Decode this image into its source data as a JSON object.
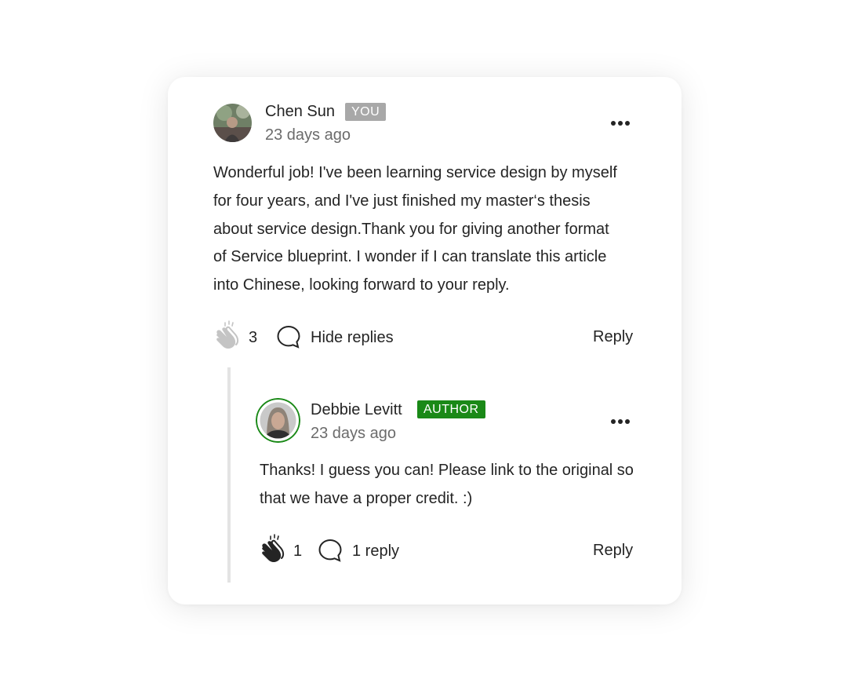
{
  "comment": {
    "author": "Chen Sun",
    "badge": "YOU",
    "time": "23 days ago",
    "text_lines": [
      "Wonderful job! I've been learning service design by myself",
      "for four years, and I've just finished my master‘s thesis",
      "about service design.Thank you for giving another format",
      "of Service blueprint. I wonder if I can translate this article",
      "into Chinese, looking forward to your reply."
    ],
    "claps": "3",
    "replies_label": "Hide replies",
    "reply_label": "Reply"
  },
  "reply": {
    "author": "Debbie Levitt",
    "badge": "AUTHOR",
    "time": "23 days ago",
    "text_lines": [
      "Thanks! I guess you can! Please link to the original so",
      "that we have a proper credit. :)"
    ],
    "claps": "1",
    "replies_label": "1 reply",
    "reply_label": "Reply"
  },
  "icons": {
    "more": "more-horizontal-icon",
    "clap": "clap-icon",
    "comment": "speech-bubble-icon"
  },
  "colors": {
    "author_badge": "#1a8917",
    "you_badge": "#a8a8a8",
    "thread_line": "#e3e3e3",
    "muted_text": "#6b6b6b",
    "clap_inactive": "#c4c4c4"
  }
}
